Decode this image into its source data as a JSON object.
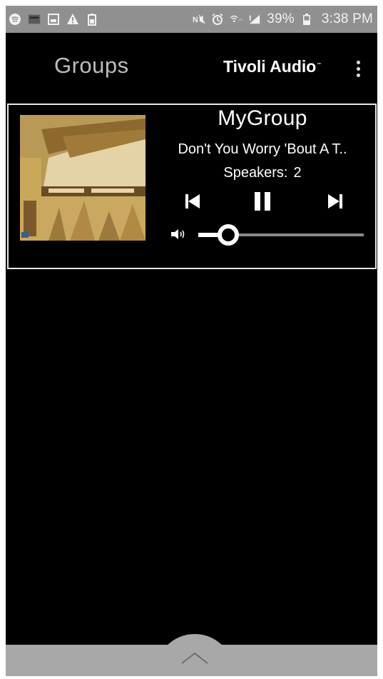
{
  "status_bar": {
    "left_icons": [
      "spotify-icon",
      "app-thumbnail-icon",
      "image-icon",
      "warning-icon",
      "battery-saver-icon"
    ],
    "right_icons": [
      "nfc-mute-icon",
      "alarm-icon",
      "wifi-icon",
      "signal-icon",
      "battery-icon"
    ],
    "battery_percent": "39%",
    "time": "3:38 PM"
  },
  "header": {
    "title": "Groups",
    "brand": "Tivoli Audio",
    "brand_mark": "™",
    "menu_icon": "more-vert-icon"
  },
  "group_card": {
    "group_name": "MyGroup",
    "track_title": "Don't You Worry 'Bout A T..",
    "speakers_label": "Speakers:",
    "speakers_count": "2",
    "controls": {
      "previous_icon": "skip-previous-icon",
      "pause_icon": "pause-icon",
      "next_icon": "skip-next-icon"
    },
    "volume": {
      "icon": "volume-icon",
      "level": 0.18
    }
  },
  "bottom": {
    "expand_icon": "chevron-up-icon"
  },
  "colors": {
    "background": "#000000",
    "status_bar": "#909090",
    "bottom_bar": "#a8a8a8",
    "header_title": "#bdbdbd",
    "card_border": "#e6e6e6"
  }
}
